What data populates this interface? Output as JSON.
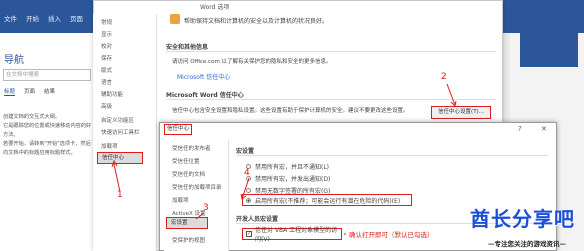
{
  "word": {
    "tabs": [
      "文件",
      "开始",
      "插入",
      "页面"
    ],
    "nav_title": "导航",
    "nav_search": "在文档中搜索",
    "nav_tabs": [
      "标题",
      "页面",
      "结果"
    ],
    "nav_text": [
      "创建文档的交互式大纲。",
      "它是跟踪您的位置或快速移动内容的好方法。",
      "若要开始，请转到\"开始\"选项卡，然后向文档中的标题应用标题样式。"
    ]
  },
  "options": {
    "title": "Word 选项",
    "sidebar": [
      "常规",
      "显示",
      "校对",
      "保存",
      "版式",
      "语言",
      "辅助功能",
      "高级",
      "自定义功能区",
      "快速访问工具栏",
      "加载项",
      "信任中心"
    ],
    "header": "帮助保持文档和计算机的安全以及计算机的状况良好。",
    "privacy_label": "安全和其他信息",
    "privacy_text": "请访问 Office.com 以了解有关保护您的隐私和安全的更多信息。",
    "privacy_link": "Microsoft 信任中心",
    "trust_label": "Microsoft Word 信任中心",
    "trust_text": "信任中心包含安全设置和隐私设置。这些设置有助于保护计算机的安全。建议不要更改这些设置。",
    "trust_button": "信任中心设置(T)..."
  },
  "trust_center": {
    "title": "信任中心",
    "help": "?",
    "close": "✕",
    "sidebar": [
      "受信任的发布者",
      "受信任位置",
      "受信任的文档",
      "受信任的加载项目录",
      "加载项",
      "ActiveX 设置",
      "宏设置",
      "受保护的视图"
    ],
    "macro_label": "宏设置",
    "macro_options": [
      "禁用所有宏，并且不通知(L)",
      "禁用所有宏，并发出通知(D)",
      "禁用无数字签署的所有宏(G)",
      "启用所有宏(不推荐；可能会运行有潜在危险的代码)(E)"
    ],
    "dev_label": "开发人员宏设置",
    "dev_checkbox": "信任对 VBA 工程对象模型的访问(V)"
  },
  "annotations": {
    "step1": "1",
    "step2": "2",
    "step3": "3",
    "step4": "4",
    "confirm": "确认打开即可（默认已勾选）"
  },
  "watermark": {
    "brand": "酋长分享吧",
    "slogan": "—专注您关注的游戏资讯—"
  }
}
